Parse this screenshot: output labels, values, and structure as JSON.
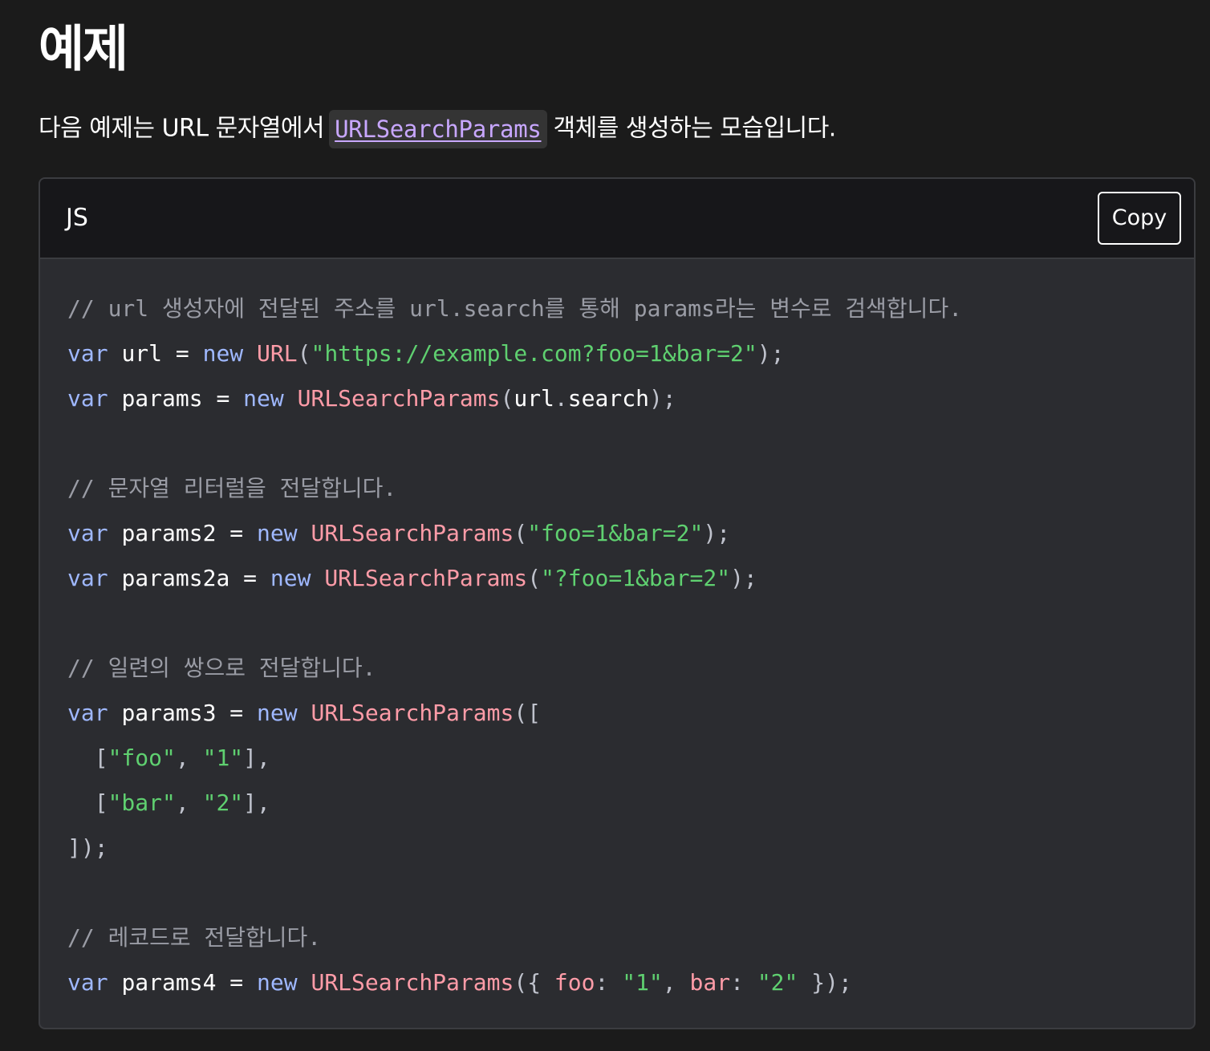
{
  "heading": "예제",
  "intro": {
    "before": "다음 예제는 URL 문자열에서",
    "link": "URLSearchParams",
    "after": "객체를 생성하는 모습입니다."
  },
  "code_block": {
    "language": "JS",
    "copy_label": "Copy",
    "lines": [
      [
        {
          "t": "comment",
          "v": "// url 생성자에 전달된 주소를 url.search를 통해 params라는 변수로 검색합니다."
        }
      ],
      [
        {
          "t": "keyword",
          "v": "var"
        },
        {
          "t": "plain",
          "v": " "
        },
        {
          "t": "ident",
          "v": "url"
        },
        {
          "t": "plain",
          "v": " = "
        },
        {
          "t": "keyword",
          "v": "new"
        },
        {
          "t": "plain",
          "v": " "
        },
        {
          "t": "class",
          "v": "URL"
        },
        {
          "t": "punct",
          "v": "("
        },
        {
          "t": "string",
          "v": "\"https://example.com?foo=1&bar=2\""
        },
        {
          "t": "punct",
          "v": ");"
        }
      ],
      [
        {
          "t": "keyword",
          "v": "var"
        },
        {
          "t": "plain",
          "v": " "
        },
        {
          "t": "ident",
          "v": "params"
        },
        {
          "t": "plain",
          "v": " = "
        },
        {
          "t": "keyword",
          "v": "new"
        },
        {
          "t": "plain",
          "v": " "
        },
        {
          "t": "class",
          "v": "URLSearchParams"
        },
        {
          "t": "punct",
          "v": "("
        },
        {
          "t": "ident",
          "v": "url"
        },
        {
          "t": "punct",
          "v": "."
        },
        {
          "t": "ident",
          "v": "search"
        },
        {
          "t": "punct",
          "v": ");"
        }
      ],
      [],
      [
        {
          "t": "comment",
          "v": "// 문자열 리터럴을 전달합니다."
        }
      ],
      [
        {
          "t": "keyword",
          "v": "var"
        },
        {
          "t": "plain",
          "v": " "
        },
        {
          "t": "ident",
          "v": "params2"
        },
        {
          "t": "plain",
          "v": " = "
        },
        {
          "t": "keyword",
          "v": "new"
        },
        {
          "t": "plain",
          "v": " "
        },
        {
          "t": "class",
          "v": "URLSearchParams"
        },
        {
          "t": "punct",
          "v": "("
        },
        {
          "t": "string",
          "v": "\"foo=1&bar=2\""
        },
        {
          "t": "punct",
          "v": ");"
        }
      ],
      [
        {
          "t": "keyword",
          "v": "var"
        },
        {
          "t": "plain",
          "v": " "
        },
        {
          "t": "ident",
          "v": "params2a"
        },
        {
          "t": "plain",
          "v": " = "
        },
        {
          "t": "keyword",
          "v": "new"
        },
        {
          "t": "plain",
          "v": " "
        },
        {
          "t": "class",
          "v": "URLSearchParams"
        },
        {
          "t": "punct",
          "v": "("
        },
        {
          "t": "string",
          "v": "\"?foo=1&bar=2\""
        },
        {
          "t": "punct",
          "v": ");"
        }
      ],
      [],
      [
        {
          "t": "comment",
          "v": "// 일련의 쌍으로 전달합니다."
        }
      ],
      [
        {
          "t": "keyword",
          "v": "var"
        },
        {
          "t": "plain",
          "v": " "
        },
        {
          "t": "ident",
          "v": "params3"
        },
        {
          "t": "plain",
          "v": " = "
        },
        {
          "t": "keyword",
          "v": "new"
        },
        {
          "t": "plain",
          "v": " "
        },
        {
          "t": "class",
          "v": "URLSearchParams"
        },
        {
          "t": "punct",
          "v": "(["
        }
      ],
      [
        {
          "t": "plain",
          "v": "  "
        },
        {
          "t": "punct",
          "v": "["
        },
        {
          "t": "string",
          "v": "\"foo\""
        },
        {
          "t": "punct",
          "v": ", "
        },
        {
          "t": "string",
          "v": "\"1\""
        },
        {
          "t": "punct",
          "v": "],"
        }
      ],
      [
        {
          "t": "plain",
          "v": "  "
        },
        {
          "t": "punct",
          "v": "["
        },
        {
          "t": "string",
          "v": "\"bar\""
        },
        {
          "t": "punct",
          "v": ", "
        },
        {
          "t": "string",
          "v": "\"2\""
        },
        {
          "t": "punct",
          "v": "],"
        }
      ],
      [
        {
          "t": "punct",
          "v": "]);"
        }
      ],
      [],
      [
        {
          "t": "comment",
          "v": "// 레코드로 전달합니다."
        }
      ],
      [
        {
          "t": "keyword",
          "v": "var"
        },
        {
          "t": "plain",
          "v": " "
        },
        {
          "t": "ident",
          "v": "params4"
        },
        {
          "t": "plain",
          "v": " = "
        },
        {
          "t": "keyword",
          "v": "new"
        },
        {
          "t": "plain",
          "v": " "
        },
        {
          "t": "class",
          "v": "URLSearchParams"
        },
        {
          "t": "punct",
          "v": "({ "
        },
        {
          "t": "prop",
          "v": "foo"
        },
        {
          "t": "punct",
          "v": ": "
        },
        {
          "t": "string",
          "v": "\"1\""
        },
        {
          "t": "punct",
          "v": ", "
        },
        {
          "t": "prop",
          "v": "bar"
        },
        {
          "t": "punct",
          "v": ": "
        },
        {
          "t": "string",
          "v": "\"2\""
        },
        {
          "t": "punct",
          "v": " });"
        }
      ]
    ]
  },
  "colors": {
    "page_background": "#1b1b1b",
    "code_background": "#2b2c30",
    "header_background": "#17171a",
    "link": "#c8a7ff",
    "keyword": "#9fb8ff",
    "class": "#ff9ca8",
    "string": "#5fd070",
    "comment": "#9a9ca5"
  }
}
